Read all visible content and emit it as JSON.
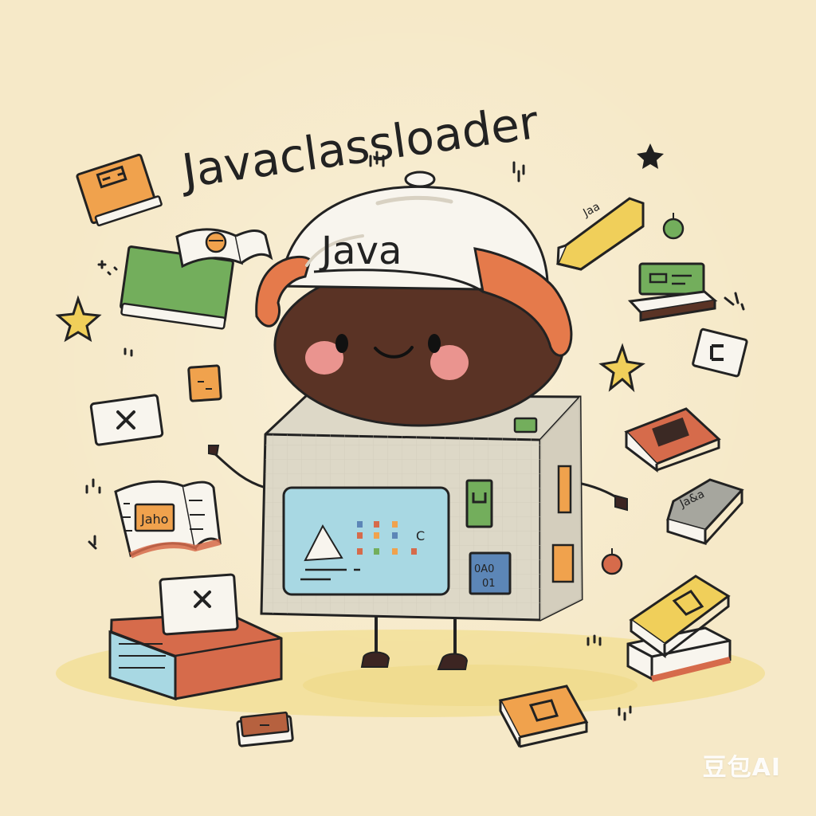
{
  "title": "Javaclassloader",
  "hat_text": "Java",
  "book_label_left": "Jaho",
  "screen_glyph_top": "C",
  "screen_glyph_bottom_1": "0A0",
  "screen_glyph_bottom_2": "01",
  "book_label_right_top": "Jaa",
  "book_label_right_middle": "Ja&a",
  "watermark": "豆包AI",
  "colors": {
    "background": "#f6e9c8",
    "ink": "#222222",
    "hat_white": "#f8f5ee",
    "hat_orange": "#e57a4b",
    "face_brown": "#5a3325",
    "blush_pink": "#f29a95",
    "box_gray": "#ddd8c7",
    "screen_blue": "#a8d8e3",
    "green": "#73ae5c",
    "orange": "#f0a24d",
    "yellow": "#f0cf5a",
    "red": "#d66b4b",
    "blue": "#5c86b7"
  }
}
